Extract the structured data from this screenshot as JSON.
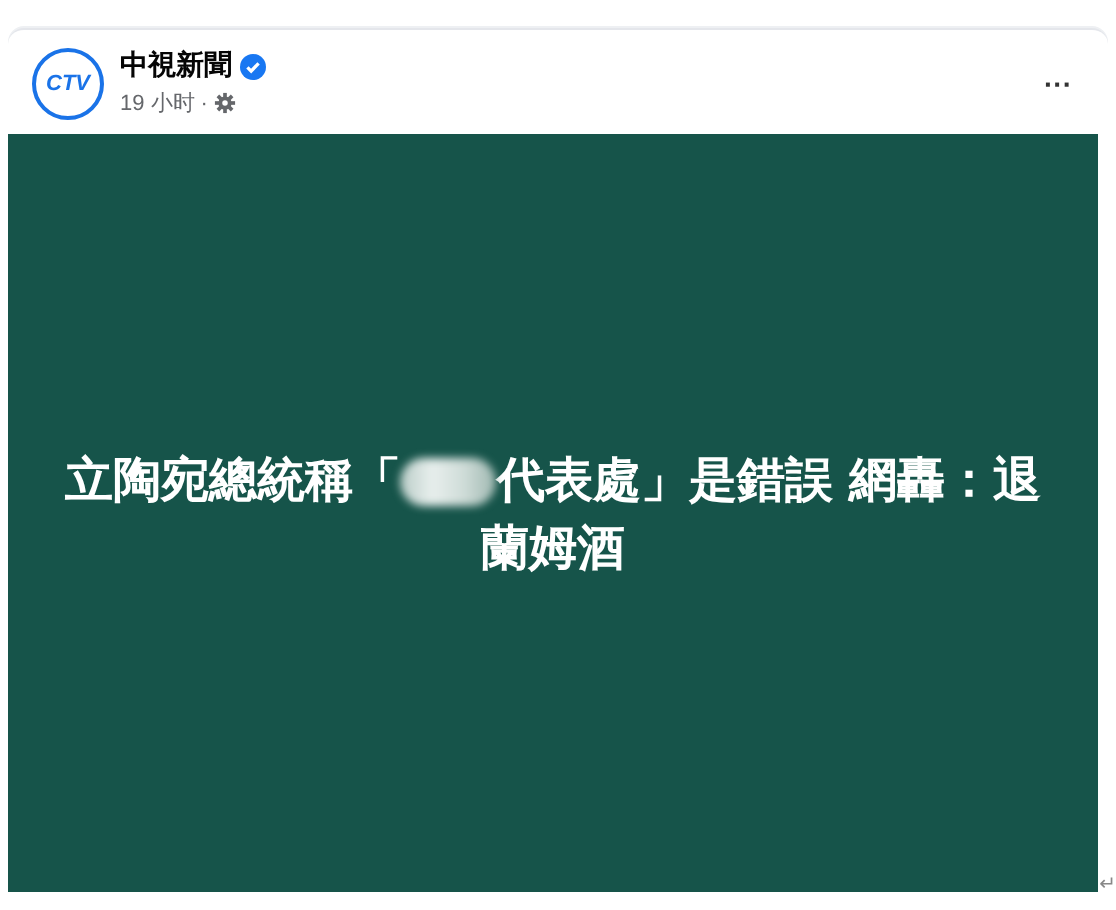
{
  "post": {
    "page_name": "中視新聞",
    "verified": true,
    "logo": "CTV",
    "time": "19 小时",
    "separator": "·",
    "more": "···"
  },
  "image": {
    "headline_start": "立陶宛總統稱「",
    "blurred": true,
    "headline_end": "代表處」是錯誤 網轟：退蘭姆酒"
  },
  "paragraph_mark": "↵"
}
